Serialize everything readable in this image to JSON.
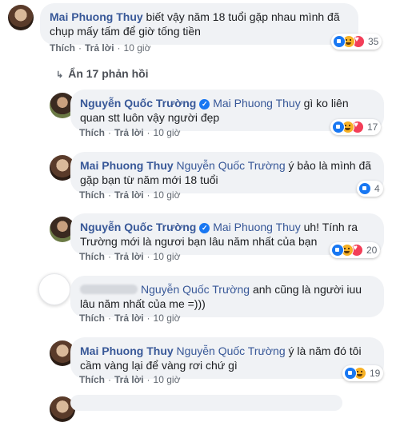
{
  "comments": [
    {
      "author": "Mai Phuong Thuy",
      "text": "biết vậy năm 18 tuổi gặp nhau mình đã chụp mấy tấm để giờ tống tiền",
      "like": "Thích",
      "reply": "Trả lời",
      "time": "10 giờ",
      "reactions": "35"
    },
    {
      "author": "Nguyễn Quốc Trường",
      "tag": "Mai Phuong Thuy",
      "text": "gì ko liên quan stt luôn vậy người đẹp",
      "like": "Thích",
      "reply": "Trả lời",
      "time": "10 giờ",
      "reactions": "17"
    },
    {
      "author": "Mai Phuong Thuy",
      "tag": "Nguyễn Quốc Trường",
      "text": "ý bảo là mình đã gặp bạn từ năm mới 18 tuổi",
      "like": "Thích",
      "reply": "Trả lời",
      "time": "10 giờ",
      "reactions": "4"
    },
    {
      "author": "Nguyễn Quốc Trường",
      "tag": "Mai Phuong Thuy",
      "text": "uh! Tính ra Trường mới là ngươi bạn lâu năm nhất của bạn",
      "like": "Thích",
      "reply": "Trả lời",
      "time": "10 giờ",
      "reactions": "20"
    },
    {
      "tag": "Nguyễn Quốc Trường",
      "text": "anh cũng là người iuu lâu năm nhất của me =)))",
      "like": "Thích",
      "reply": "Trả lời",
      "time": "10 giờ"
    },
    {
      "author": "Mai Phuong Thuy",
      "tag": "Nguyễn Quốc Trường",
      "text": "ý là năm đó tôi cầm vàng lại để vàng rơi chứ gì",
      "like": "Thích",
      "reply": "Trả lời",
      "time": "10 giờ",
      "reactions": "19"
    }
  ],
  "hide_replies": "Ẩn 17 phản hồi",
  "verified_mark": "✓"
}
